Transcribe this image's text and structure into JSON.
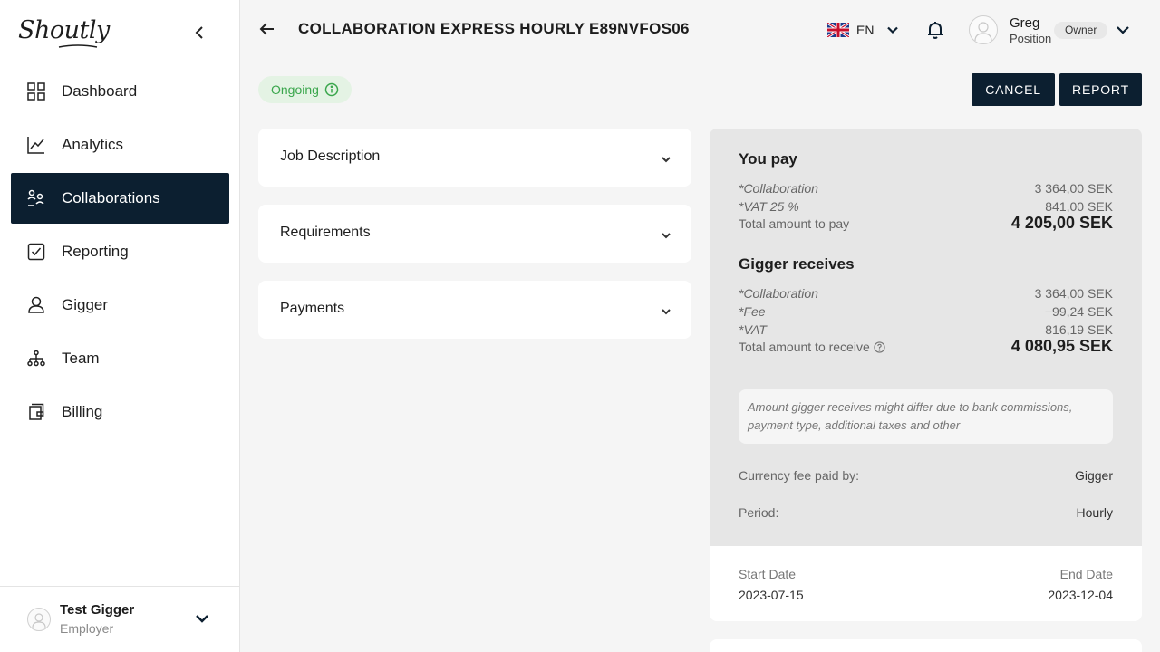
{
  "sidebar": {
    "logo": "Shoutly",
    "items": [
      {
        "label": "Dashboard",
        "icon": "dashboard-icon"
      },
      {
        "label": "Analytics",
        "icon": "analytics-icon"
      },
      {
        "label": "Collaborations",
        "icon": "collaborations-icon",
        "active": true
      },
      {
        "label": "Reporting",
        "icon": "reporting-icon"
      },
      {
        "label": "Gigger",
        "icon": "gigger-icon"
      },
      {
        "label": "Team",
        "icon": "team-icon"
      },
      {
        "label": "Billing",
        "icon": "billing-icon"
      }
    ],
    "user": {
      "name": "Test Gigger",
      "role": "Employer"
    }
  },
  "header": {
    "title": "COLLABORATION EXPRESS HOURLY E89NVFOS06",
    "language": "EN",
    "user": {
      "name": "Greg",
      "position": "Position",
      "badge": "Owner"
    }
  },
  "status": {
    "label": "Ongoing",
    "color": "#3aa64c"
  },
  "actions": {
    "cancel": "CANCEL",
    "report": "REPORT"
  },
  "accordions": [
    {
      "label": "Job Description"
    },
    {
      "label": "Requirements"
    },
    {
      "label": "Payments"
    }
  ],
  "payment": {
    "you_pay": {
      "title": "You pay",
      "rows": [
        {
          "label": "*Collaboration",
          "value": "3 364,00 SEK"
        },
        {
          "label": "*VAT 25 %",
          "value": "841,00 SEK"
        }
      ],
      "total_label": "Total amount to pay",
      "total_value": "4 205,00 SEK"
    },
    "gigger_receives": {
      "title": "Gigger receives",
      "rows": [
        {
          "label": "*Collaboration",
          "value": "3 364,00 SEK"
        },
        {
          "label": "*Fee",
          "value": "−99,24 SEK"
        },
        {
          "label": "*VAT",
          "value": "816,19 SEK"
        }
      ],
      "total_label": "Total amount to receive",
      "total_value": "4 080,95 SEK"
    },
    "note": "Amount gigger receives might differ due to bank commissions, payment type, additional taxes and other",
    "currency_fee_label": "Currency fee paid by:",
    "currency_fee_value": "Gigger",
    "period_label": "Period:",
    "period_value": "Hourly"
  },
  "dates": {
    "start_label": "Start Date",
    "start_value": "2023-07-15",
    "end_label": "End Date",
    "end_value": "2023-12-04"
  },
  "colors": {
    "primary": "#0c1f30",
    "success": "#3aa64c",
    "panel": "#e6e6e6"
  }
}
